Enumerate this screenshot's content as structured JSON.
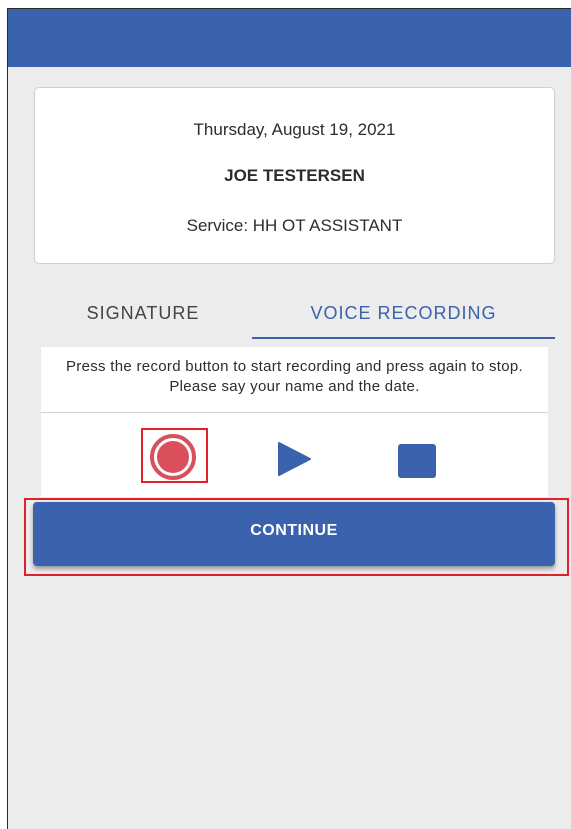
{
  "info": {
    "date": "Thursday, August 19, 2021",
    "name": "JOE TESTERSEN",
    "service": "Service: HH OT ASSISTANT"
  },
  "tabs": [
    {
      "label": "SIGNATURE",
      "active": false
    },
    {
      "label": "VOICE RECORDING",
      "active": true
    }
  ],
  "recording": {
    "instructions": "Press the record button to start recording and press again to stop. Please say your name and the date.",
    "controls": [
      {
        "icon": "record-icon",
        "color": "#d9505c"
      },
      {
        "icon": "play-icon",
        "color": "#3a62ad"
      },
      {
        "icon": "stop-icon",
        "color": "#3a62ad"
      }
    ]
  },
  "continue_label": "CONTINUE",
  "colors": {
    "primary": "#3a62ad",
    "record": "#d9505c",
    "highlight": "#e0202a",
    "background": "#ececec"
  }
}
